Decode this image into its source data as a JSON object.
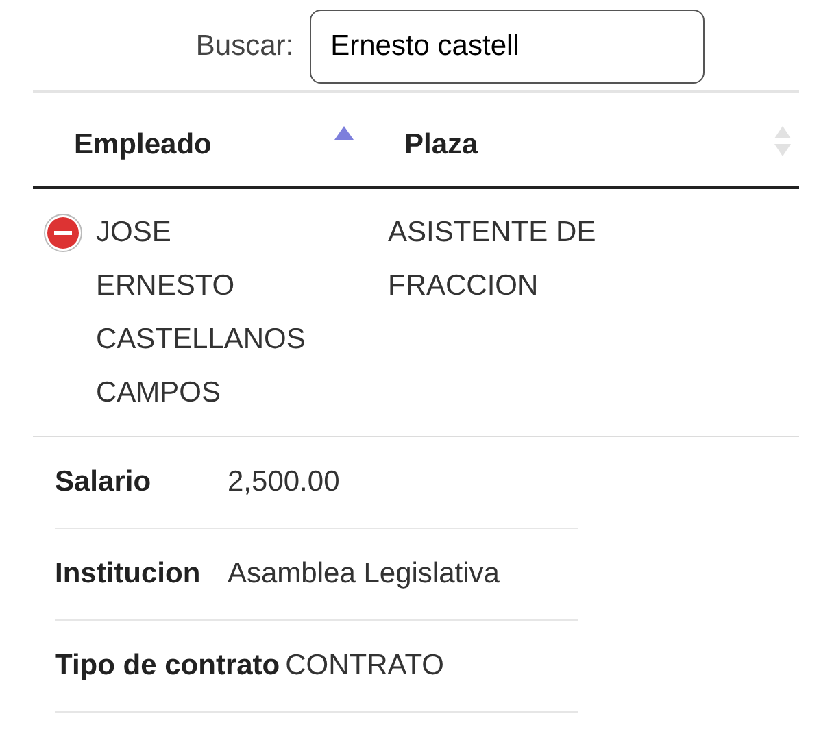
{
  "search": {
    "label": "Buscar:",
    "value": "Ernesto castell"
  },
  "columns": [
    {
      "label": "Empleado",
      "sorted": true,
      "descending": false
    },
    {
      "label": "Plaza",
      "sorted": false
    }
  ],
  "rows": [
    {
      "expanded": true,
      "cells": [
        "JOSE ERNESTO CASTELLANOS CAMPOS",
        "ASISTENTE DE FRACCION"
      ],
      "details": [
        {
          "label": "Salario",
          "value": "2,500.00"
        },
        {
          "label": "Institucion",
          "value": "Asamblea Legislativa"
        },
        {
          "label": "Tipo de contrato",
          "value": "CONTRATO"
        }
      ]
    }
  ]
}
